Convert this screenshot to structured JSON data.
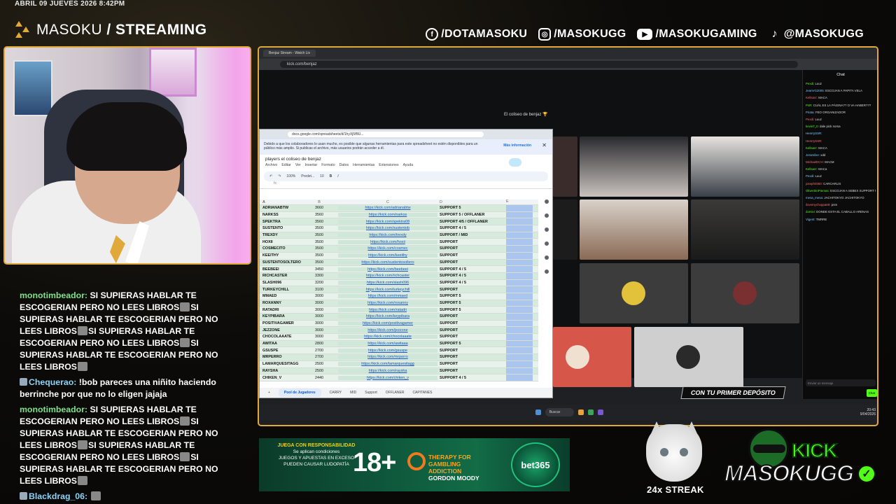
{
  "header": {
    "date": "ABRIL 09 JUEVES 2026 8:42PM",
    "brand_light": "MASOKU ",
    "brand_bold": "/ STREAMING",
    "socials": [
      {
        "icon": "facebook-icon",
        "label": "/DOTAMASOKU"
      },
      {
        "icon": "instagram-icon",
        "label": "/MASOKUGG"
      },
      {
        "icon": "youtube-icon",
        "label": "/MASOKUGAMING"
      },
      {
        "icon": "tiktok-icon",
        "label": "@MASOKUGG"
      }
    ]
  },
  "colors": {
    "accent": "#e0a93a",
    "kick_green": "#53fc18",
    "sheet_green": "#d7ebdd"
  },
  "stream_chat": [
    {
      "user": "monotimbeador:",
      "text": "SI SUPIERAS HABLAR TE ESCOGERIAN PERO NO LEES LIBROS",
      "text2": "SI SUPIERAS HABLAR TE ESCOGERIAN PERO NO LEES LIBROS",
      "text3": "SI SUPIERAS HABLAR TE ESCOGERIAN PERO NO LEES LIBROS",
      "text4": "SI SUPIERAS HABLAR TE ESCOGERIAN PERO NO LEES LIBROS"
    },
    {
      "user": "Chequerao:",
      "text": "!bob pareces una niñito haciendo berrinche por que no lo eligen jajaja"
    },
    {
      "user": "monotimbeador:",
      "text": "SI SUPIERAS HABLAR TE ESCOGERIAN PERO NO LEES LIBROS",
      "text2": "SI SUPIERAS HABLAR TE ESCOGERIAN PERO NO LEES LIBROS",
      "text3": "SI SUPIERAS HABLAR TE ESCOGERIAN PERO NO LEES LIBROS",
      "text4": "SI SUPIERAS HABLAR TE ESCOGERIAN PERO NO LEES LIBROS"
    },
    {
      "user": "Blackdrag_06:",
      "text": ""
    }
  ],
  "browser": {
    "tab": "Benjaz Stream - Watch Liv",
    "url": "kick.com/benjaz"
  },
  "kick": {
    "stream_title": "El coliseo de benjaz 🏆",
    "chat_title": "Chat",
    "deposit_banner": "CON TU PRIMER DEPÓSITO",
    "chat_input_placeholder": "Enviar un mensaje",
    "chat_send": "Chat",
    "chat_lines": [
      {
        "u": "Pexdi:",
        "t": "Luuz"
      },
      {
        "u": "JeanVG2005:",
        "t": "ESCOJAN A PAPITA VELA"
      },
      {
        "u": "Kellsarz:",
        "t": "MACA"
      },
      {
        "u": "PsR:",
        "t": "CUÁL ES LA PÁGINA?? O VA HABER???"
      },
      {
        "u": "Pirata:",
        "t": "FEO ORGANIZADOR"
      },
      {
        "u": "Pexdi:",
        "t": "Luuz"
      },
      {
        "u": "kevin7_0:",
        "t": "dale pick noma"
      },
      {
        "u": "HenrrySSR:",
        "t": ""
      },
      {
        "u": "HenrrySSR:",
        "t": ""
      },
      {
        "u": "Kellsarz:",
        "t": "MACA"
      },
      {
        "u": "Jeramilxe:",
        "t": "xdd"
      },
      {
        "u": "MichaelDCH:",
        "t": "MACM"
      },
      {
        "u": "Kellsarz:",
        "t": "MACa"
      },
      {
        "u": "Pexdi:",
        "t": "Luuz"
      },
      {
        "u": "joseph0350:",
        "t": "CARCARLIS"
      },
      {
        "u": "OliverSinPiernas:",
        "t": "ESCOJAN A SEBEX SUPPORT 5 NETO TE QUITA CREEPS"
      },
      {
        "u": "mesa_mesa:",
        "t": "JACHITOKYO JACHITOKYO"
      },
      {
        "u": "ilovemychoppa69:",
        "t": "pnm"
      },
      {
        "u": "domivi:",
        "t": "DONDE ESTA EL CABALLO ARENAS"
      },
      {
        "u": "Vigent:",
        "t": "TMRRE"
      }
    ]
  },
  "sheet": {
    "url": "docs.google.com/spreadsheets/d/1hyXj5fBU...",
    "info": "Debido a que los colaboradores lo usan mucho, es posible que algunas herramientas para este spreadsheet no estén disponibles para un público más amplio. Si publicas el archivo, más usuarios podrán acceder a él.",
    "more_info": "Más información",
    "title": "players el coliseo de benjaz",
    "menus": [
      "Archivo",
      "Editar",
      "Ver",
      "Insertar",
      "Formato",
      "Datos",
      "Herramientas",
      "Extensiones",
      "Ayuda"
    ],
    "zoom": "100%",
    "font": "Predet...",
    "font_size": "10",
    "columns": [
      "A",
      "B",
      "C",
      "D",
      "E"
    ],
    "rows": [
      [
        "ADRIANABTW",
        "3660",
        "https://kick.com/adrianabtw",
        "SUPPORT 5"
      ],
      [
        "NARKSS",
        "3560",
        "https://kick.com/narkss",
        "SUPPORT 5 / OFFLANER"
      ],
      [
        "SPEKTRA",
        "3560",
        "https://kick.com/spektra08",
        "SUPPORT 4/5 / OFFLANER"
      ],
      [
        "SUSTENTO",
        "3500",
        "https://kick.com/sustentob",
        "SUPPORT 4 / 5"
      ],
      [
        "TREXDY",
        "3500",
        "https://kick.com/trexdy",
        "SUPPORT / MID"
      ],
      [
        "HOXII",
        "3500",
        "https://kick.com/hoxii",
        "SUPPORT"
      ],
      [
        "COSMECITO",
        "3500",
        "https://kick.com/cosmec",
        "SUPPORT"
      ],
      [
        "KEEITHY",
        "3500",
        "https://kick.com/keeithy",
        "SUPPORT"
      ],
      [
        "SUSTENTOSOLTERO",
        "3500",
        "https://kick.com/sustentosoltero",
        "SUPPORT"
      ],
      [
        "BEEBEEI",
        "3450",
        "https://kick.com/beebeei",
        "SUPPORT 4 / 5"
      ],
      [
        "RICHCASTER",
        "3300",
        "https://kick.com/richcaster",
        "SUPPORT 4 / 5"
      ],
      [
        "SLASH096",
        "3200",
        "https://kick.com/slash096",
        "SUPPORT 4 / 5"
      ],
      [
        "TURKEYCHILL",
        "3100",
        "https://kick.com/turkeychill",
        "SUPPORT"
      ],
      [
        "MMAED",
        "3000",
        "https://kick.com/mmaed",
        "SUPPORT 5"
      ],
      [
        "ROXANNY",
        "3000",
        "https://kick.com/roxanny",
        "SUPPORT 5"
      ],
      [
        "RATADRI",
        "3000",
        "https://kick.com/ratadri",
        "SUPPORT 5"
      ],
      [
        "KEYPIBARA",
        "3000",
        "https://kick.com/keypibara",
        "SUPPORT"
      ],
      [
        "POSITIVAGAMER",
        "3000",
        "https://kick.com/positivagamer",
        "SUPPORT"
      ],
      [
        "JEZZONE",
        "3000",
        "https://kick.com/jezzone",
        "SUPPORT"
      ],
      [
        "CHOCOLAAATE",
        "3000",
        "https://kick.com/chocolaaate",
        "SUPPORT"
      ],
      [
        "AWITAA",
        "2800",
        "https://kick.com/awitaaa",
        "SUPPORT 5"
      ],
      [
        "GSUSPE",
        "2700",
        "https://kick.com/gsuspe",
        "SUPPORT"
      ],
      [
        "MRPERRO",
        "2700",
        "https://kick.com/mrperro",
        "SUPPORT"
      ],
      [
        "LAMARQUESITAGG",
        "2500",
        "https://kick.com/lamarquesitagg",
        "SUPPORT"
      ],
      [
        "RAYSHA",
        "2500",
        "https://kick.com/raysha",
        "SUPPORT"
      ],
      [
        "CHIKEN_V",
        "2440",
        "https://kick.com/chiken_v",
        "SUPPORT 4 / 5"
      ]
    ],
    "tabs": [
      "Pool de Jugadores",
      "CARRY",
      "MID",
      "Support",
      "OFFLANER",
      "CAPITANES"
    ]
  },
  "taskbar": {
    "search": "Buscar",
    "time": "20:43",
    "date": "9/04/2026"
  },
  "ad": {
    "responsible": "JUEGA CON RESPONSABILIDAD",
    "conditions": "Se aplican condiciones",
    "warning": "JUEGOS Y APUESTAS EN EXCESO PUEDEN CAUSAR LUDOPATÍA",
    "age": "18+",
    "therapy": "THERAPY FOR GAMBLING ADDICTION",
    "therapy_by": "GORDON MOODY",
    "bet": "bet365"
  },
  "streak": "24x STREAK",
  "kick_logo": {
    "kick": "KICK",
    "name": "MASOKUGG"
  }
}
